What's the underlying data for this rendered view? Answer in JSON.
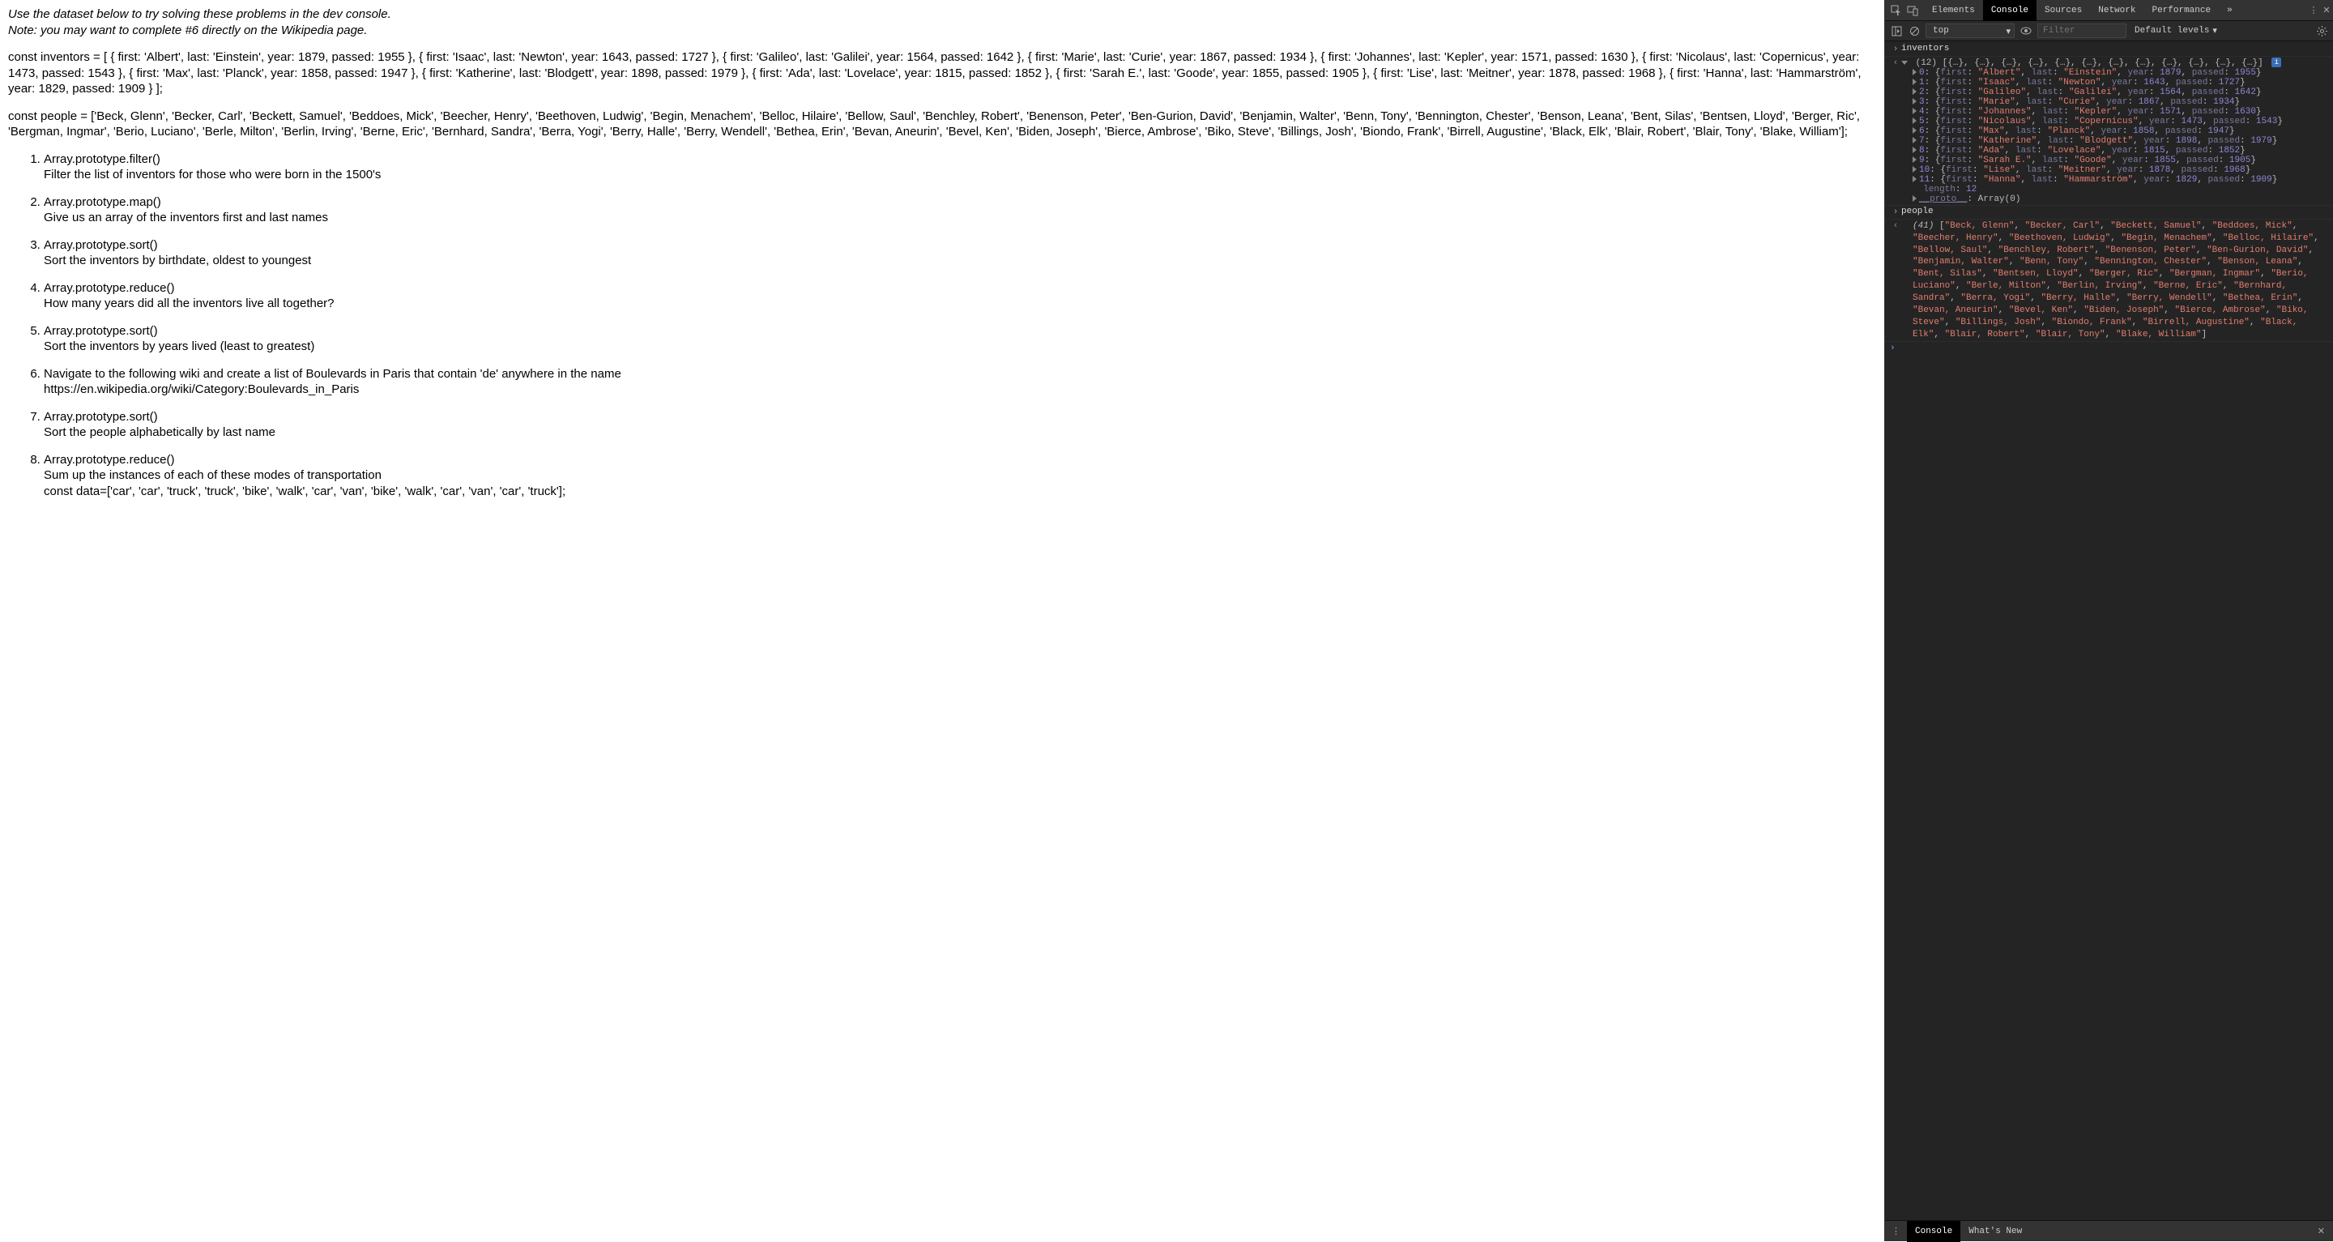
{
  "page": {
    "intro1": "Use the dataset below to try solving these problems in the dev console.",
    "intro2": "Note: you may want to complete #6 directly on the Wikipedia page.",
    "inventors_code": "const inventors = [ { first: 'Albert', last: 'Einstein', year: 1879, passed: 1955 }, { first: 'Isaac', last: 'Newton', year: 1643, passed: 1727 }, { first: 'Galileo', last: 'Galilei', year: 1564, passed: 1642 }, { first: 'Marie', last: 'Curie', year: 1867, passed: 1934 }, { first: 'Johannes', last: 'Kepler', year: 1571, passed: 1630 }, { first: 'Nicolaus', last: 'Copernicus', year: 1473, passed: 1543 }, { first: 'Max', last: 'Planck', year: 1858, passed: 1947 }, { first: 'Katherine', last: 'Blodgett', year: 1898, passed: 1979 }, { first: 'Ada', last: 'Lovelace', year: 1815, passed: 1852 }, { first: 'Sarah E.', last: 'Goode', year: 1855, passed: 1905 }, { first: 'Lise', last: 'Meitner', year: 1878, passed: 1968 }, { first: 'Hanna', last: 'Hammarström', year: 1829, passed: 1909 } ];",
    "people_code": "const people = ['Beck, Glenn', 'Becker, Carl', 'Beckett, Samuel', 'Beddoes, Mick', 'Beecher, Henry', 'Beethoven, Ludwig', 'Begin, Menachem', 'Belloc, Hilaire', 'Bellow, Saul', 'Benchley, Robert', 'Benenson, Peter', 'Ben-Gurion, David', 'Benjamin, Walter', 'Benn, Tony', 'Bennington, Chester', 'Benson, Leana', 'Bent, Silas', 'Bentsen, Lloyd', 'Berger, Ric', 'Bergman, Ingmar', 'Berio, Luciano', 'Berle, Milton', 'Berlin, Irving', 'Berne, Eric', 'Bernhard, Sandra', 'Berra, Yogi', 'Berry, Halle', 'Berry, Wendell', 'Bethea, Erin', 'Bevan, Aneurin', 'Bevel, Ken', 'Biden, Joseph', 'Bierce, Ambrose', 'Biko, Steve', 'Billings, Josh', 'Biondo, Frank', 'Birrell, Augustine', 'Black, Elk', 'Blair, Robert', 'Blair, Tony', 'Blake, William'];",
    "problems": [
      {
        "h": "Array.prototype.filter()",
        "t": "Filter the list of inventors for those who were born in the 1500's"
      },
      {
        "h": "Array.prototype.map()",
        "t": "Give us an array of the inventors first and last names"
      },
      {
        "h": "Array.prototype.sort()",
        "t": "Sort the inventors by birthdate, oldest to youngest"
      },
      {
        "h": "Array.prototype.reduce()",
        "t": "How many years did all the inventors live all together?"
      },
      {
        "h": "Array.prototype.sort()",
        "t": "Sort the inventors by years lived (least to greatest)"
      },
      {
        "h": "Navigate to the following wiki and create a list of Boulevards in Paris that contain 'de' anywhere in the name",
        "t": "https://en.wikipedia.org/wiki/Category:Boulevards_in_Paris"
      },
      {
        "h": "Array.prototype.sort()",
        "t": "Sort the people alphabetically by last name"
      },
      {
        "h": "Array.prototype.reduce()",
        "t": "Sum up the instances of each of these modes of transportation",
        "t2": "const data=['car', 'car', 'truck', 'truck', 'bike', 'walk', 'car', 'van', 'bike', 'walk', 'car', 'van', 'car', 'truck'];"
      }
    ]
  },
  "devtools": {
    "tabs": [
      "Elements",
      "Console",
      "Sources",
      "Network",
      "Performance"
    ],
    "active_tab": "Console",
    "more": "»",
    "context": "top",
    "filter_placeholder": "Filter",
    "levels": "Default levels",
    "input1": "inventors",
    "array_header": "(12) [{…}, {…}, {…}, {…}, {…}, {…}, {…}, {…}, {…}, {…}, {…}, {…}]",
    "inventors": [
      {
        "first": "Albert",
        "last": "Einstein",
        "year": 1879,
        "passed": 1955
      },
      {
        "first": "Isaac",
        "last": "Newton",
        "year": 1643,
        "passed": 1727
      },
      {
        "first": "Galileo",
        "last": "Galilei",
        "year": 1564,
        "passed": 1642
      },
      {
        "first": "Marie",
        "last": "Curie",
        "year": 1867,
        "passed": 1934
      },
      {
        "first": "Johannes",
        "last": "Kepler",
        "year": 1571,
        "passed": 1630
      },
      {
        "first": "Nicolaus",
        "last": "Copernicus",
        "year": 1473,
        "passed": 1543
      },
      {
        "first": "Max",
        "last": "Planck",
        "year": 1858,
        "passed": 1947
      },
      {
        "first": "Katherine",
        "last": "Blodgett",
        "year": 1898,
        "passed": 1979
      },
      {
        "first": "Ada",
        "last": "Lovelace",
        "year": 1815,
        "passed": 1852
      },
      {
        "first": "Sarah E.",
        "last": "Goode",
        "year": 1855,
        "passed": 1905
      },
      {
        "first": "Lise",
        "last": "Meitner",
        "year": 1878,
        "passed": 1968
      },
      {
        "first": "Hanna",
        "last": "Hammarström",
        "year": 1829,
        "passed": 1909
      }
    ],
    "length_label": "length",
    "length_val": "12",
    "proto_label": "__proto__",
    "proto_val": "Array(0)",
    "input2": "people",
    "people_count": "(41)",
    "people": [
      "Beck, Glenn",
      "Becker, Carl",
      "Beckett, Samuel",
      "Beddoes, Mick",
      "Beecher, Henry",
      "Beethoven, Ludwig",
      "Begin, Menachem",
      "Belloc, Hilaire",
      "Bellow, Saul",
      "Benchley, Robert",
      "Benenson, Peter",
      "Ben-Gurion, David",
      "Benjamin, Walter",
      "Benn, Tony",
      "Bennington, Chester",
      "Benson, Leana",
      "Bent, Silas",
      "Bentsen, Lloyd",
      "Berger, Ric",
      "Bergman, Ingmar",
      "Berio, Luciano",
      "Berle, Milton",
      "Berlin, Irving",
      "Berne, Eric",
      "Bernhard, Sandra",
      "Berra, Yogi",
      "Berry, Halle",
      "Berry, Wendell",
      "Bethea, Erin",
      "Bevan, Aneurin",
      "Bevel, Ken",
      "Biden, Joseph",
      "Bierce, Ambrose",
      "Biko, Steve",
      "Billings, Josh",
      "Biondo, Frank",
      "Birrell, Augustine",
      "Black, Elk",
      "Blair, Robert",
      "Blair, Tony",
      "Blake, William"
    ],
    "drawer_tabs": [
      "Console",
      "What's New"
    ]
  }
}
